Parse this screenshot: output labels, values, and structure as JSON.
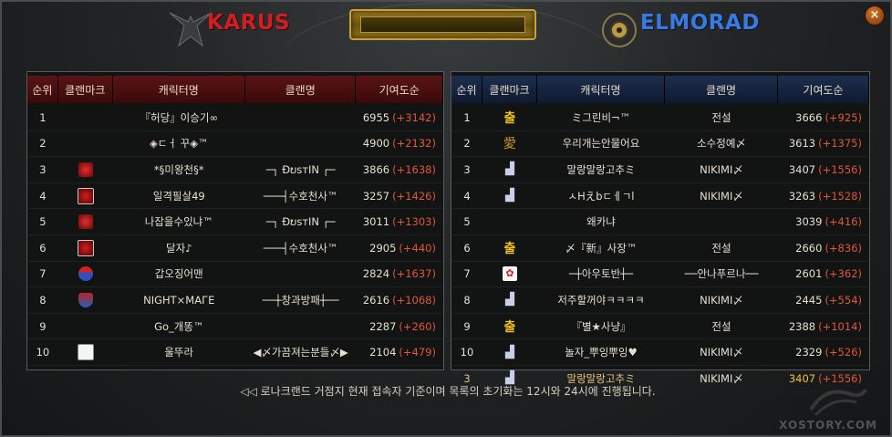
{
  "header": {
    "karus_title": "KARUS",
    "elmorad_title": "ELMORAD",
    "close_label": "×"
  },
  "columns": {
    "rank": "순위",
    "clan_mark": "클랜마크",
    "character": "캐릭터명",
    "clan": "클랜명",
    "score": "기여도순"
  },
  "karus_rows": [
    {
      "rank": "1",
      "mark": "none",
      "char": "『허당』이승기∞",
      "clan": "",
      "score": "6955",
      "plus": "(+3142)"
    },
    {
      "rank": "2",
      "mark": "none",
      "char": "◈ㄷㅓ 꾸◈™",
      "clan": "",
      "score": "4900",
      "plus": "(+2132)"
    },
    {
      "rank": "3",
      "mark": "red",
      "char": "*§미왕천§*",
      "clan": "─┐ ÐບѕтΙΝ ┌─",
      "score": "3866",
      "plus": "(+1638)"
    },
    {
      "rank": "4",
      "mark": "redsq",
      "char": "일격필살49",
      "clan": "───┤수호천사™",
      "score": "3257",
      "plus": "(+1426)"
    },
    {
      "rank": "5",
      "mark": "red",
      "char": "나잡을수있냐™",
      "clan": "─┐ ÐບѕтΙΝ ┌─",
      "score": "3011",
      "plus": "(+1303)"
    },
    {
      "rank": "6",
      "mark": "redsq",
      "char": "달자♪",
      "clan": "───┤수호천사™",
      "score": "2905",
      "plus": "(+440)"
    },
    {
      "rank": "7",
      "mark": "mario",
      "char": "갑오징어맨",
      "clan": "",
      "score": "2824",
      "plus": "(+1637)"
    },
    {
      "rank": "8",
      "mark": "knight",
      "char": "NΙGHT×MAГE",
      "clan": "──┼창과방패┼──",
      "score": "2616",
      "plus": "(+1068)"
    },
    {
      "rank": "9",
      "mark": "none",
      "char": "Go_개똥™",
      "clan": "",
      "score": "2287",
      "plus": "(+260)"
    },
    {
      "rank": "10",
      "mark": "panda",
      "char": "울뚜라",
      "clan": "◀〆가끔져는분들〆▶",
      "score": "2104",
      "plus": "(+479)"
    }
  ],
  "elmorad_rows": [
    {
      "rank": "1",
      "mark": "gold",
      "char": "ミ그린비¬™",
      "clan": "전설",
      "score": "3666",
      "plus": "(+925)",
      "highlight": false
    },
    {
      "rank": "2",
      "mark": "gold2",
      "char": "우리개는안물어요",
      "clan": "소수정예〆",
      "score": "3613",
      "plus": "(+1375)",
      "highlight": false
    },
    {
      "rank": "3",
      "mark": "castle",
      "char": "말랑말랑고추ミ",
      "clan": "NIKIMI〆",
      "score": "3407",
      "plus": "(+1556)",
      "highlight": false
    },
    {
      "rank": "4",
      "mark": "castle",
      "char": "ㅅHえbㄷㅔㄱl",
      "clan": "NIKIMI〆",
      "score": "3263",
      "plus": "(+1528)",
      "highlight": false
    },
    {
      "rank": "5",
      "mark": "none",
      "char": "왜카냐",
      "clan": "",
      "score": "3039",
      "plus": "(+416)",
      "highlight": false
    },
    {
      "rank": "6",
      "mark": "gold",
      "char": "〆『新』사장™",
      "clan": "전설",
      "score": "2660",
      "plus": "(+836)",
      "highlight": false
    },
    {
      "rank": "7",
      "mark": "flower",
      "char": "─┼아우토반┼─",
      "clan": "──안나푸르나──",
      "score": "2601",
      "plus": "(+362)",
      "highlight": false
    },
    {
      "rank": "8",
      "mark": "castle",
      "char": "저주할꺼야ㅋㅋㅋㅋ",
      "clan": "NIKIMI〆",
      "score": "2445",
      "plus": "(+554)",
      "highlight": false
    },
    {
      "rank": "9",
      "mark": "gold",
      "char": "『별★사냥』",
      "clan": "전설",
      "score": "2388",
      "plus": "(+1014)",
      "highlight": false
    },
    {
      "rank": "10",
      "mark": "castle",
      "char": "놀자_뿌잉뿌잉♥",
      "clan": "NIKIMI〆",
      "score": "2329",
      "plus": "(+526)",
      "highlight": false
    },
    {
      "rank": "3",
      "mark": "castle",
      "char": "말랑말랑고추ミ",
      "clan": "NIKIMI〆",
      "score": "3407",
      "plus": "(+1556)",
      "highlight": true
    }
  ],
  "mark_glyphs": {
    "gold": "출",
    "gold2": "愛",
    "castle": "▟",
    "flower": "✿"
  },
  "footer": {
    "notice": "◁◁ 로나크랜드 거점지 현재 접속자 기준이며 목록의 초기화는 12시와 24시에 진행됩니다."
  },
  "watermark": "XOSTORY.COM",
  "colors": {
    "karus": "#d01e22",
    "elmorad": "#3a7ae0",
    "plus": "#e0573a",
    "highlight": "#f0c23a"
  }
}
